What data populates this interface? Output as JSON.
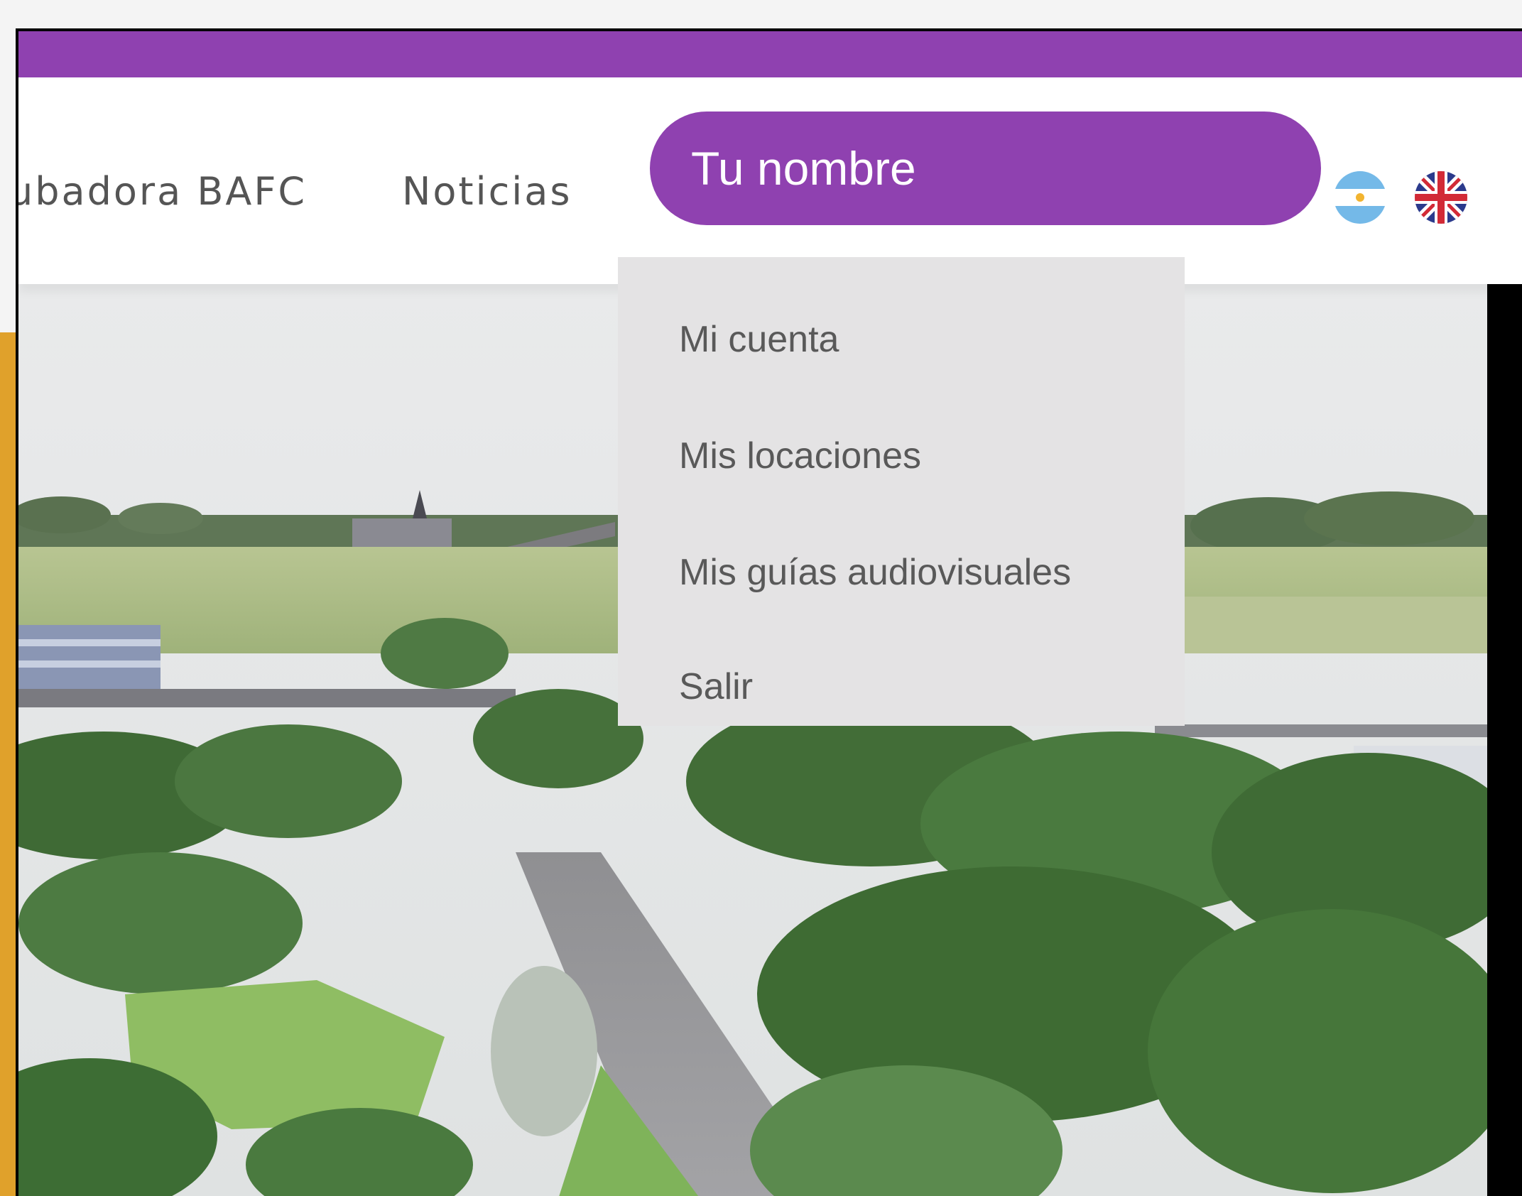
{
  "header": {
    "nav_items": [
      {
        "label": "ubadora BAFC"
      },
      {
        "label": "Noticias"
      }
    ],
    "user_menu": {
      "label": "Tu nombre",
      "items": [
        {
          "label": "Mi cuenta"
        },
        {
          "label": "Mis locaciones"
        },
        {
          "label": "Mis guías audiovisuales"
        },
        {
          "label": "Salir"
        }
      ]
    },
    "languages": [
      {
        "icon": "argentina-flag-icon"
      },
      {
        "icon": "uk-flag-icon"
      }
    ]
  },
  "colors": {
    "brand_purple": "#8f41b0",
    "accent_orange": "#e0a12b",
    "dropdown_bg": "#e4e3e4",
    "nav_text": "#555555"
  },
  "hero": {
    "icon": "aerial-city-park-image"
  }
}
